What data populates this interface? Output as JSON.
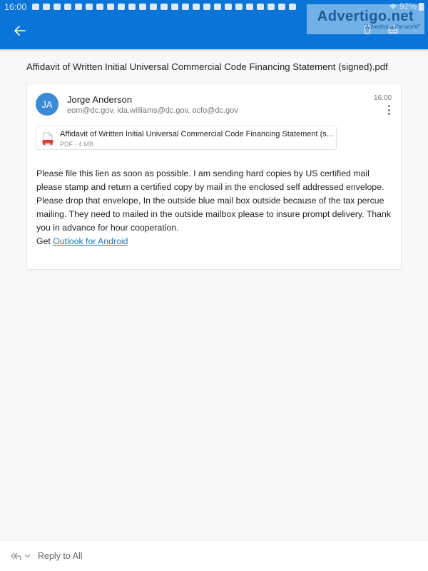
{
  "status_bar": {
    "time": "16:00",
    "battery": "92%",
    "notification_icons": [
      "navigation-icon",
      "youtube-icon",
      "youtube-icon",
      "youtube-icon",
      "facebook-icon",
      "download-icon",
      "chrome-icon",
      "app-icon",
      "app-icon",
      "app-icon",
      "app-icon",
      "app-icon",
      "chrome-icon",
      "chrome-icon",
      "app-icon",
      "instagram-icon",
      "instagram-icon",
      "alert-icon",
      "gmail-icon",
      "shield-icon",
      "wrench-icon",
      "kik-icon",
      "app-icon",
      "twitter-icon",
      "download-icon"
    ]
  },
  "watermark": {
    "title": "Advertigo.net",
    "tagline": "\"Advertising the world\""
  },
  "header": {
    "back_label": "Back",
    "actions": [
      "delete",
      "archive",
      "more"
    ]
  },
  "email": {
    "subject": "Affidavit of Written Initial Universal Commercial Code Financing Statement (signed).pdf",
    "sender": {
      "initials": "JA",
      "name": "Jorge Anderson",
      "avatar_color": "#3a8ad6"
    },
    "recipients": "eom@dc.gov, ida.williams@dc.gov, ocfo@dc.gov",
    "time": "16:00",
    "attachment": {
      "name": "Affidavit of Written Initial Universal Commercial Code Financing Statement (s...",
      "meta": "PDF · 4 MB"
    },
    "body": "Please file this lien as soon as possible. I am sending hard copies by US certified mail please stamp and return a certified copy by mail in the enclosed self addressed envelope. Please drop that envelope, In the outside blue mail box outside because of the tax percue mailing. They need to mailed in the outside mailbox please to insure prompt delivery. Thank you in advance for hour cooperation.",
    "signature_prefix": "Get ",
    "signature_link": "Outlook for Android"
  },
  "footer": {
    "reply_label": "Reply to All"
  },
  "colors": {
    "brand": "#0a74d8",
    "link": "#1a7bc9"
  }
}
